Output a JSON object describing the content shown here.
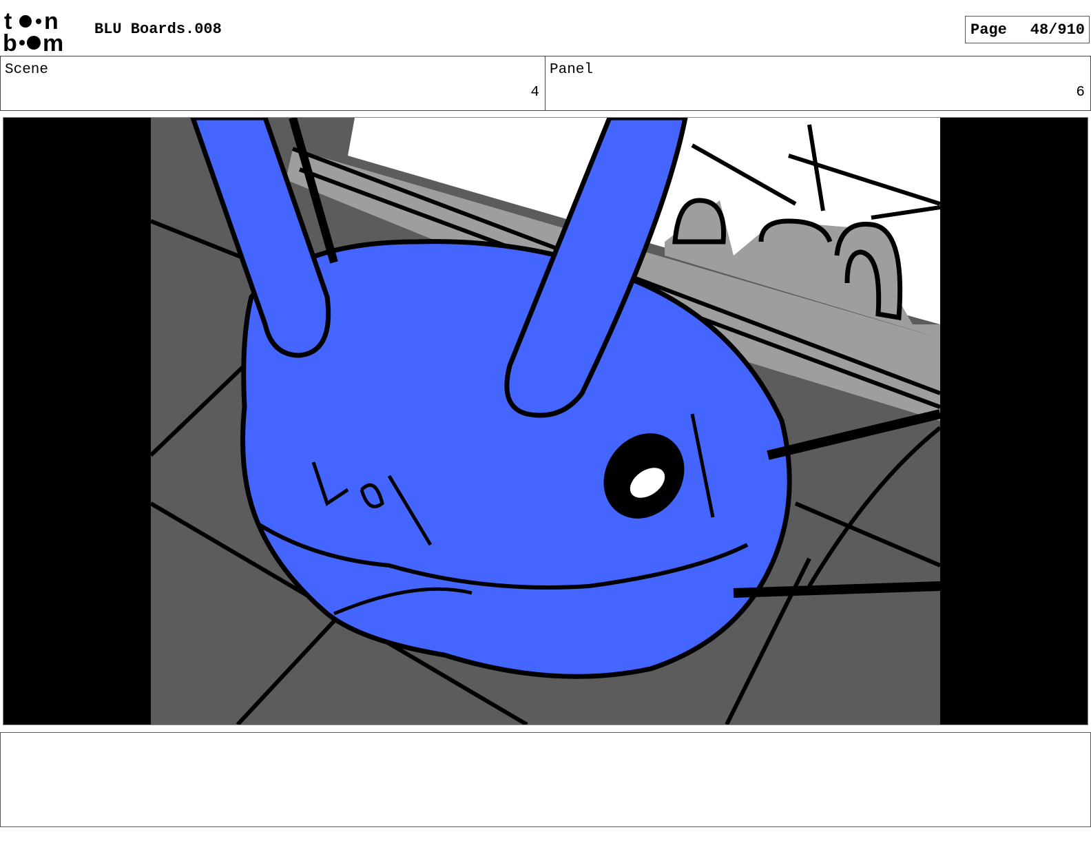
{
  "header": {
    "logo_text": "toon boom",
    "document_title": "BLU Boards.008",
    "page_label": "Page",
    "page_number": "48/910"
  },
  "scene": {
    "label": "Scene",
    "value": "4"
  },
  "panel": {
    "label": "Panel",
    "value": "6"
  },
  "frame": {
    "image_name": "storyboard-panel-image",
    "colors": {
      "character": "#4466FF",
      "floor": "#5C5C5C",
      "counter": "#9E9E9E",
      "letterbox": "#000000",
      "sky": "#FFFFFF"
    }
  },
  "notes": {
    "text": ""
  }
}
